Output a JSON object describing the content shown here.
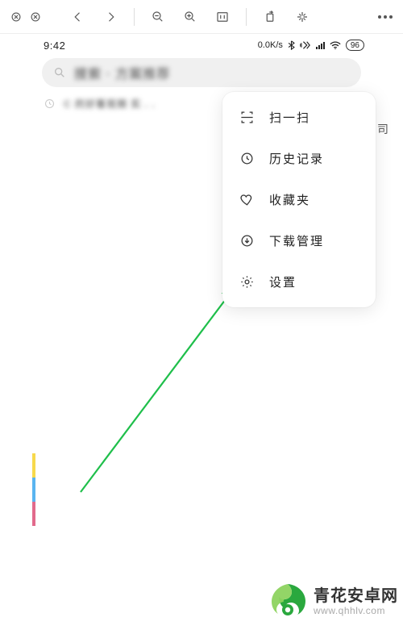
{
  "status": {
    "time": "9:42",
    "speed": "0.0K/s",
    "battery": "96"
  },
  "search": {
    "placeholder_blurred": "搜索 · 方案推荐"
  },
  "history": {
    "row_blurred": "C 的好看视频 实 . .",
    "trail_char": "司"
  },
  "menu": {
    "items": [
      {
        "key": "scan",
        "label": "扫一扫"
      },
      {
        "key": "history",
        "label": "历史记录"
      },
      {
        "key": "favorites",
        "label": "收藏夹"
      },
      {
        "key": "downloads",
        "label": "下载管理"
      },
      {
        "key": "settings",
        "label": "设置"
      }
    ]
  },
  "annotation": {
    "arrow_color": "#1fbf4b"
  },
  "side_colors": [
    "#f7d94c",
    "#5ab4f0",
    "#e26a8c"
  ],
  "watermark": {
    "title": "青花安卓网",
    "subtitle": "www.qhhlv.com",
    "logo_colors": {
      "base": "#2aa83e",
      "accent": "#8dd35f"
    }
  }
}
